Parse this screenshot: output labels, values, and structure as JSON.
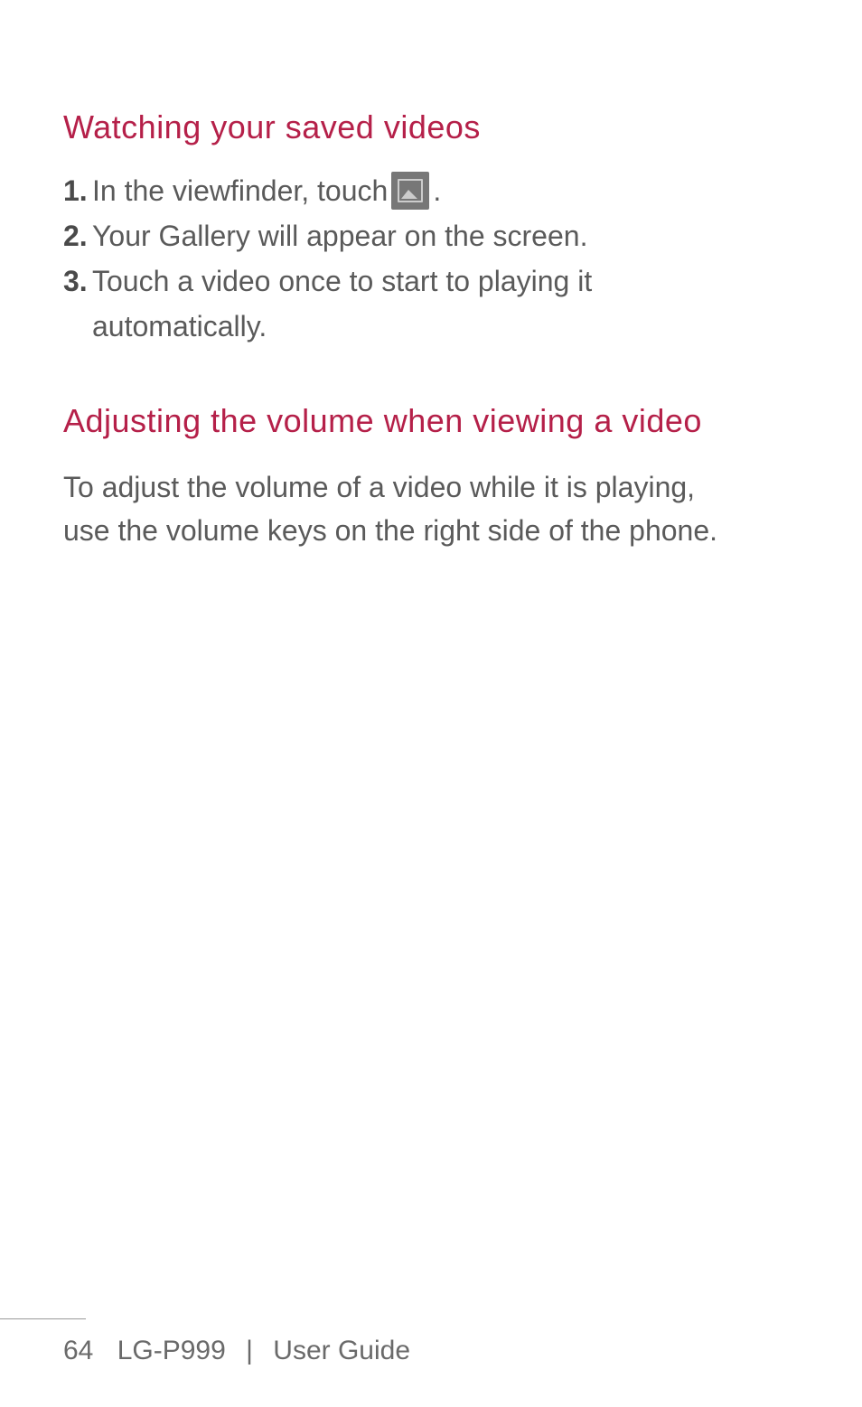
{
  "section1": {
    "heading": "Watching your saved videos",
    "items": [
      {
        "number": "1.",
        "text_before_icon": "In the viewfinder, touch ",
        "text_after_icon": "."
      },
      {
        "number": "2.",
        "text": "Your Gallery will appear on the screen."
      },
      {
        "number": "3.",
        "text_line1": "Touch a video once to start to playing it",
        "text_line2": "automatically."
      }
    ]
  },
  "section2": {
    "heading": "Adjusting the volume when viewing a video",
    "body_line1": "To adjust the volume of a video while it is playing,",
    "body_line2": "use the volume keys on the right side of the phone."
  },
  "footer": {
    "page_number": "64",
    "model": "LG-P999",
    "divider": "|",
    "guide_label": "User Guide"
  }
}
